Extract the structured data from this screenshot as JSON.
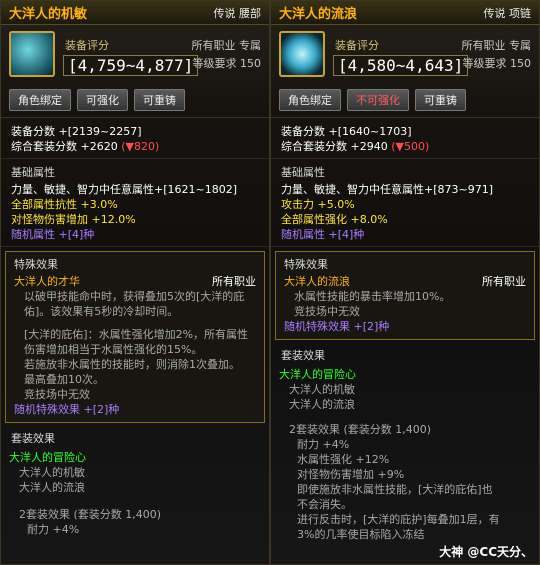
{
  "left": {
    "title": "大洋人的机敏",
    "tags": "传说 腰部",
    "score_label": "装备评分",
    "score_range": "[4,759~4,877]",
    "job": "所有职业 专属",
    "level": "等级要求 150",
    "buttons": [
      "角色绑定",
      "可强化",
      "可重铸"
    ],
    "stats": [
      "装备分数 +[2139~2257]",
      "综合套装分数 +2620 (▼820)"
    ],
    "base_title": "基础属性",
    "base_lines": [
      "力量、敏捷、智力中任意属性+[1621~1802]",
      "全部属性抗性 +3.0%",
      "对怪物伤害增加 +12.0%",
      "随机属性 +[4]种"
    ],
    "special_title": "特殊效果",
    "sp_name": "大洋人的才华",
    "sp_job": "所有职业",
    "sp_lines": [
      "以破甲技能命中时，获得叠加5次的[大洋的庇",
      "佑]。该效果有5秒的冷却时间。",
      "",
      "[大洋的庇佑]：水属性强化增加2%，所有属性",
      "伤害增加相当于水属性强化的15%。",
      "若施放非水属性的技能时，则消除1次叠加。",
      "最高叠加10次。",
      "竞技场中无效"
    ],
    "random_special": "随机特殊效果 +[2]种",
    "set_title": "套装效果",
    "set_name": "大洋人的冒险心",
    "set_pieces": [
      "大洋人的机敏",
      "大洋人的流浪"
    ],
    "set_bonus": [
      "2套装效果 (套装分数 1,400)",
      "耐力 +4%"
    ]
  },
  "right": {
    "title": "大洋人的流浪",
    "tags": "传说 项链",
    "score_label": "装备评分",
    "score_range": "[4,580~4,643]",
    "job": "所有职业 专属",
    "level": "等级要求 150",
    "buttons": [
      "角色绑定",
      "不可强化",
      "可重铸"
    ],
    "stats": [
      "装备分数 +[1640~1703]",
      "综合套装分数 +2940 (▼500)"
    ],
    "base_title": "基础属性",
    "base_lines": [
      "力量、敏捷、智力中任意属性+[873~971]",
      "攻击力 +5.0%",
      "全部属性强化 +8.0%",
      "随机属性 +[4]种"
    ],
    "special_title": "特殊效果",
    "sp_name": "大洋人的流浪",
    "sp_job": "所有职业",
    "sp_lines": [
      "水属性技能的暴击率增加10%。",
      "竞技场中无效"
    ],
    "random_special": "随机特殊效果 +[2]种",
    "set_title": "套装效果",
    "set_name": "大洋人的冒险心",
    "set_pieces": [
      "大洋人的机敏",
      "大洋人的流浪"
    ],
    "set_bonus": [
      "2套装效果 (套装分数 1,400)",
      "耐力 +4%",
      "水属性强化 +12%",
      "对怪物伤害增加 +9%",
      "即使施放非水属性技能，[大洋的庇佑]也",
      "不会消失。",
      "进行反击时，[大洋的庇护]每叠加1层，有",
      "3%的几率使目标陷入冻结"
    ]
  },
  "watermark": "大神 @CC天分、"
}
